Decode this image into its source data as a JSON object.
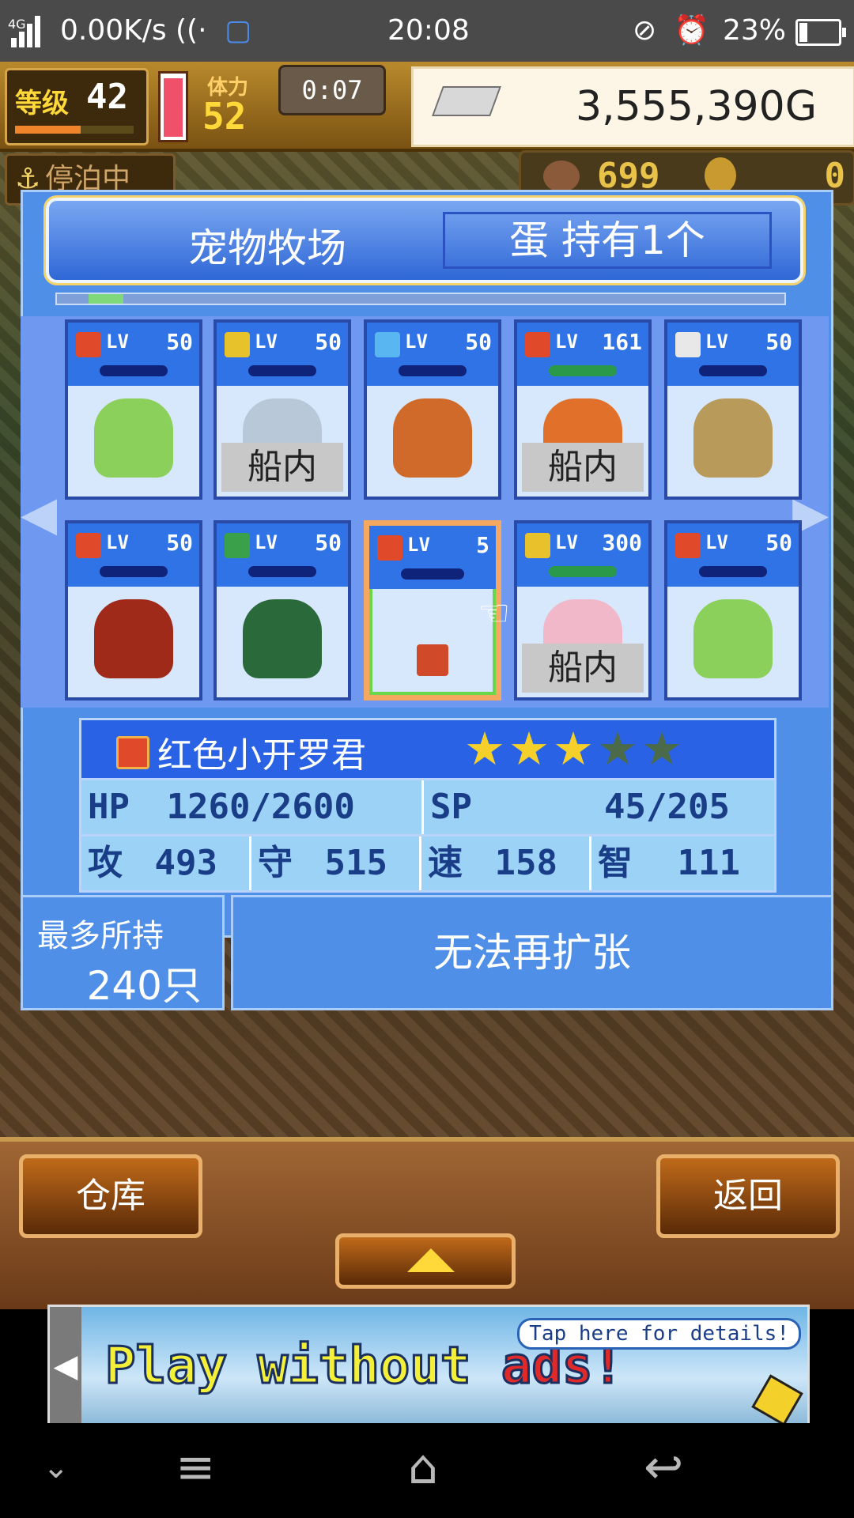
{
  "status_bar": {
    "network": "4G",
    "speed": "0.00K/s",
    "time": "20:08",
    "battery": "23%",
    "icons": [
      "signal-icon",
      "wifi-icon",
      "chat-notify-icon",
      "mute-icon",
      "alarm-icon",
      "battery-icon"
    ]
  },
  "top_bar": {
    "level_label": "等级",
    "level": "42",
    "level_progress": 0.55,
    "stamina_label": "体力",
    "stamina": "52",
    "timer": "0:07",
    "gold": "3,555,390G",
    "anchor_label": "停泊中",
    "medals": "699",
    "coins": "0"
  },
  "panel": {
    "title": "宠物牧场",
    "egg_status": "蛋 持有1个"
  },
  "pets": [
    {
      "element": "fire",
      "element_color": "#e04a2a",
      "lv_label": "LV",
      "level": "50",
      "onboard": "",
      "sprite_color": "#8bd05a"
    },
    {
      "element": "thunder",
      "element_color": "#e8c22a",
      "lv_label": "LV",
      "level": "50",
      "onboard": "船内",
      "sprite_color": "#b8c8d8"
    },
    {
      "element": "water",
      "element_color": "#5ab6f0",
      "lv_label": "LV",
      "level": "50",
      "onboard": "",
      "sprite_color": "#d06a2a"
    },
    {
      "element": "fire",
      "element_color": "#e04a2a",
      "lv_label": "LV",
      "level": "161",
      "onboard": "船内",
      "sprite_color": "#e0702a"
    },
    {
      "element": "wind",
      "element_color": "#e8e8e8",
      "lv_label": "LV",
      "level": "50",
      "onboard": "",
      "sprite_color": "#b89a5a"
    },
    {
      "element": "fire",
      "element_color": "#e04a2a",
      "lv_label": "LV",
      "level": "50",
      "onboard": "",
      "sprite_color": "#a02a1a"
    },
    {
      "element": "earth",
      "element_color": "#3aa04a",
      "lv_label": "LV",
      "level": "50",
      "onboard": "",
      "sprite_color": "#2a6a3a"
    },
    {
      "element": "fire",
      "element_color": "#e04a2a",
      "lv_label": "LV",
      "level": "5",
      "onboard": "",
      "sprite_color": "#d04a2a"
    },
    {
      "element": "thunder",
      "element_color": "#e8c22a",
      "lv_label": "LV",
      "level": "300",
      "onboard": "船内",
      "sprite_color": "#f0b8c8"
    },
    {
      "element": "fire",
      "element_color": "#e04a2a",
      "lv_label": "LV",
      "level": "50",
      "onboard": "",
      "sprite_color": "#8bd05a"
    }
  ],
  "selected": {
    "name": "红色小开罗君",
    "stars": 3,
    "max_stars": 5,
    "hp_label": "HP",
    "hp": "1260/2600",
    "sp_label": "SP",
    "sp": "45/205",
    "atk_label": "攻",
    "atk": "493",
    "def_label": "守",
    "def": "515",
    "spd_label": "速",
    "spd": "158",
    "int_label": "智",
    "int": "111"
  },
  "capacity": {
    "label": "最多所持",
    "value": "240只"
  },
  "expand_button": "无法再扩张",
  "buttons": {
    "warehouse": "仓库",
    "back": "返回"
  },
  "ad": {
    "text_main": "Play without ",
    "text_red": "ads!",
    "tap": "Tap here for details!"
  }
}
